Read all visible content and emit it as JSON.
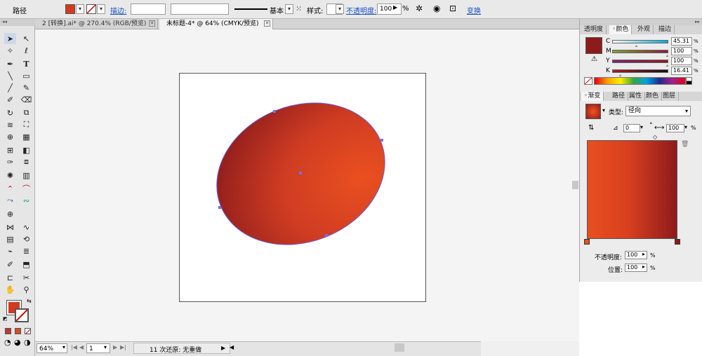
{
  "control_bar": {
    "object_type": "路径",
    "stroke_label": "描边:",
    "stroke_style": "基本",
    "style_label": "样式:",
    "opacity_label": "不透明度:",
    "opacity_value": "100",
    "opacity_unit": "%",
    "transform_label": "变换",
    "fill_color": "#d43a1c"
  },
  "document_tabs": [
    {
      "label": "2 [转换].ai* @ 270.4% (RGB/预览)",
      "active": false
    },
    {
      "label": "未标题-4* @ 64% (CMYK/预览)",
      "active": true
    }
  ],
  "status_bar": {
    "zoom": "64%",
    "page": "1",
    "undo_text": "11 次还原: 无重做"
  },
  "color_panel": {
    "tabs": [
      "透明度",
      "颜色",
      "外观",
      "描边"
    ],
    "active_tab": "颜色",
    "channels": [
      {
        "label": "C",
        "value": "45.31",
        "level": 0.45
      },
      {
        "label": "M",
        "value": "100",
        "level": 1.0
      },
      {
        "label": "Y",
        "value": "100",
        "level": 1.0
      },
      {
        "label": "K",
        "value": "16.41",
        "level": 0.16
      }
    ],
    "current_color": "#8c1b1c"
  },
  "gradient_panel": {
    "tabs": [
      "渐变",
      "路径",
      "属性",
      "颜色",
      "图层"
    ],
    "active_tab": "渐变",
    "type_label": "类型:",
    "type_value": "径向",
    "angle_value": "0",
    "angle_unit": "°",
    "aspect_value": "100",
    "aspect_unit": "%",
    "start_color": "#e84f1f",
    "end_color": "#8e1a1c",
    "opacity_label": "不透明度:",
    "opacity_value": "100",
    "opacity_unit": "%",
    "location_label": "位置:",
    "location_value": "100",
    "location_unit": "%"
  }
}
